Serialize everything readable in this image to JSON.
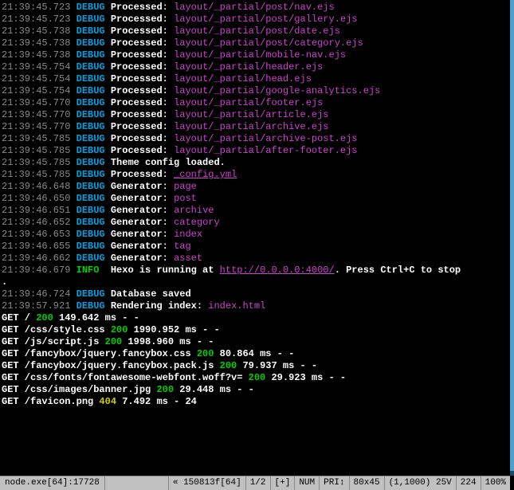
{
  "debugLines": [
    {
      "ts": "21:39:45.723",
      "level": "DEBUG",
      "label": "Processed:",
      "value": "layout/_partial/post/nav.ejs",
      "vstyle": "mag"
    },
    {
      "ts": "21:39:45.723",
      "level": "DEBUG",
      "label": "Processed:",
      "value": "layout/_partial/post/gallery.ejs",
      "vstyle": "mag"
    },
    {
      "ts": "21:39:45.738",
      "level": "DEBUG",
      "label": "Processed:",
      "value": "layout/_partial/post/date.ejs",
      "vstyle": "mag"
    },
    {
      "ts": "21:39:45.738",
      "level": "DEBUG",
      "label": "Processed:",
      "value": "layout/_partial/post/category.ejs",
      "vstyle": "mag"
    },
    {
      "ts": "21:39:45.738",
      "level": "DEBUG",
      "label": "Processed:",
      "value": "layout/_partial/mobile-nav.ejs",
      "vstyle": "mag"
    },
    {
      "ts": "21:39:45.754",
      "level": "DEBUG",
      "label": "Processed:",
      "value": "layout/_partial/header.ejs",
      "vstyle": "mag"
    },
    {
      "ts": "21:39:45.754",
      "level": "DEBUG",
      "label": "Processed:",
      "value": "layout/_partial/head.ejs",
      "vstyle": "mag"
    },
    {
      "ts": "21:39:45.754",
      "level": "DEBUG",
      "label": "Processed:",
      "value": "layout/_partial/google-analytics.ejs",
      "vstyle": "mag"
    },
    {
      "ts": "21:39:45.770",
      "level": "DEBUG",
      "label": "Processed:",
      "value": "layout/_partial/footer.ejs",
      "vstyle": "mag"
    },
    {
      "ts": "21:39:45.770",
      "level": "DEBUG",
      "label": "Processed:",
      "value": "layout/_partial/article.ejs",
      "vstyle": "mag"
    },
    {
      "ts": "21:39:45.770",
      "level": "DEBUG",
      "label": "Processed:",
      "value": "layout/_partial/archive.ejs",
      "vstyle": "mag"
    },
    {
      "ts": "21:39:45.785",
      "level": "DEBUG",
      "label": "Processed:",
      "value": "layout/_partial/archive-post.ejs",
      "vstyle": "mag"
    },
    {
      "ts": "21:39:45.785",
      "level": "DEBUG",
      "label": "Processed:",
      "value": "layout/_partial/after-footer.ejs",
      "vstyle": "mag"
    },
    {
      "ts": "21:39:45.785",
      "level": "DEBUG",
      "label": "Theme config loaded.",
      "value": "",
      "vstyle": ""
    },
    {
      "ts": "21:39:45.785",
      "level": "DEBUG",
      "label": "Processed:",
      "value": "_config.yml",
      "vstyle": "magu"
    },
    {
      "ts": "21:39:46.648",
      "level": "DEBUG",
      "label": "Generator:",
      "value": "page",
      "vstyle": "mag"
    },
    {
      "ts": "21:39:46.650",
      "level": "DEBUG",
      "label": "Generator:",
      "value": "post",
      "vstyle": "mag"
    },
    {
      "ts": "21:39:46.651",
      "level": "DEBUG",
      "label": "Generator:",
      "value": "archive",
      "vstyle": "mag"
    },
    {
      "ts": "21:39:46.652",
      "level": "DEBUG",
      "label": "Generator:",
      "value": "category",
      "vstyle": "mag"
    },
    {
      "ts": "21:39:46.653",
      "level": "DEBUG",
      "label": "Generator:",
      "value": "index",
      "vstyle": "mag"
    },
    {
      "ts": "21:39:46.655",
      "level": "DEBUG",
      "label": "Generator:",
      "value": "tag",
      "vstyle": "mag"
    },
    {
      "ts": "21:39:46.662",
      "level": "DEBUG",
      "label": "Generator:",
      "value": "asset",
      "vstyle": "mag"
    }
  ],
  "infoLine": {
    "ts": "21:39:46.679",
    "level": "INFO",
    "text1": "Hexo is running at ",
    "url": "http://0.0.0.0:4000/",
    "text2": ". Press Ctrl+C to stop"
  },
  "cursorChar": ".",
  "postDebug": [
    {
      "ts": "21:39:46.724",
      "level": "DEBUG",
      "label": "Database saved",
      "value": "",
      "vstyle": ""
    },
    {
      "ts": "21:39:57.921",
      "level": "DEBUG",
      "label": "Rendering index:",
      "value": "index.html",
      "vstyle": "mag"
    }
  ],
  "getLines": [
    {
      "method": "GET",
      "path": "/",
      "status": "200",
      "sc": "grn",
      "rest": "149.642 ms - -"
    },
    {
      "method": "GET",
      "path": "/css/style.css",
      "status": "200",
      "sc": "grn",
      "rest": "1990.952 ms - -"
    },
    {
      "method": "GET",
      "path": "/js/script.js",
      "status": "200",
      "sc": "grn",
      "rest": "1998.960 ms - -"
    },
    {
      "method": "GET",
      "path": "/fancybox/jquery.fancybox.css",
      "status": "200",
      "sc": "grn",
      "rest": "80.864 ms - -"
    },
    {
      "method": "GET",
      "path": "/fancybox/jquery.fancybox.pack.js",
      "status": "200",
      "sc": "grn",
      "rest": "79.937 ms - -"
    },
    {
      "method": "GET",
      "path": "/css/fonts/fontawesome-webfont.woff?v=",
      "status": "200",
      "sc": "grn",
      "rest": "29.923 ms - -"
    },
    {
      "method": "GET",
      "path": "/css/images/banner.jpg",
      "status": "200",
      "sc": "grn",
      "rest": "29.448 ms - -"
    },
    {
      "method": "GET",
      "path": "/favicon.png",
      "status": "404",
      "sc": "ylw",
      "rest": "7.492 ms - 24"
    }
  ],
  "status": {
    "title": "node.exe[64]:17728",
    "encoding": "« 150813f[64]",
    "split": "1/2",
    "mode": "[+]",
    "num": "NUM",
    "pri": "PRI↕",
    "size": "80x45",
    "pos": "(1,1000) 25V",
    "col": "224",
    "pct": "100%"
  }
}
